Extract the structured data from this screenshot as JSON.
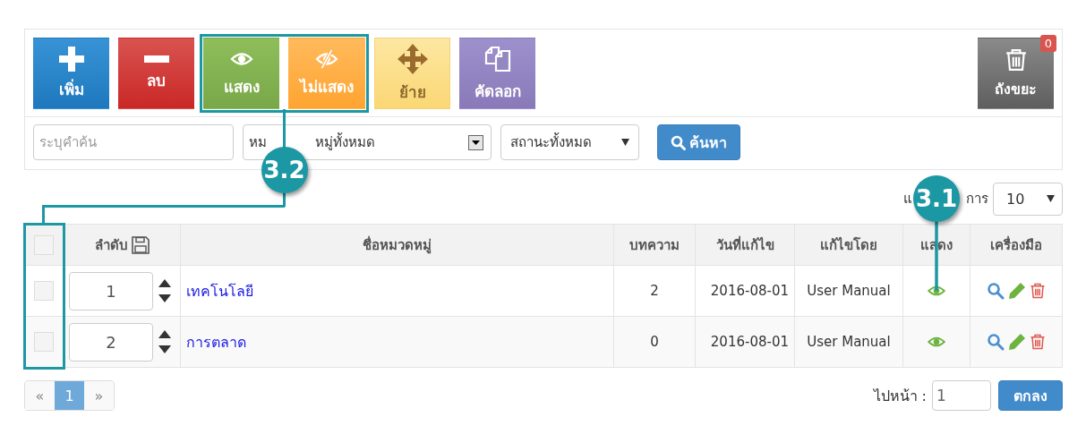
{
  "toolbar": {
    "buttons": [
      {
        "kind": "add",
        "label": "เพิ่ม"
      },
      {
        "kind": "delete",
        "label": "ลบ"
      },
      {
        "kind": "show",
        "label": "แสดง"
      },
      {
        "kind": "hide",
        "label": "ไม่แสดง"
      },
      {
        "kind": "move",
        "label": "ย้าย"
      },
      {
        "kind": "copy",
        "label": "คัดลอก"
      }
    ],
    "trash": {
      "label": "ถังขยะ",
      "badge": "0"
    }
  },
  "filters": {
    "search": {
      "placeholder": "ระบุคำค้น"
    },
    "category_select": {
      "value_parts": [
        "หม",
        "หมู่ทั้งหมด"
      ]
    },
    "status_select": {
      "value": "สถานะทั้งหมด"
    },
    "search_button": "ค้นหา"
  },
  "per_page": {
    "label_parts": [
      "แ",
      "การ"
    ],
    "value": "10"
  },
  "table": {
    "columns": [
      "ลำดับ",
      "ชื่อหมวดหมู่",
      "บทความ",
      "วันที่แก้ไข",
      "แก้ไขโดย",
      "แสดง",
      "เครื่องมือ"
    ],
    "header_checked": false,
    "rows": [
      {
        "checked": false,
        "order": "1",
        "name": "เทคโนโลยี",
        "articles": "2",
        "date": "2016-08-01",
        "by": "User Manual",
        "visible": true
      },
      {
        "checked": false,
        "order": "2",
        "name": "การตลาด",
        "articles": "0",
        "date": "2016-08-01",
        "by": "User Manual",
        "visible": true
      }
    ]
  },
  "pagination": {
    "prev": "«",
    "pages": [
      {
        "label": "1",
        "selected": true
      }
    ],
    "next": "»"
  },
  "goto": {
    "label": "ไปหน้า :",
    "value": "1",
    "button": "ตกลง"
  },
  "annotations": [
    {
      "label": "3.2",
      "kind": "frame"
    },
    {
      "label": "3.1",
      "kind": "pointer"
    }
  ]
}
